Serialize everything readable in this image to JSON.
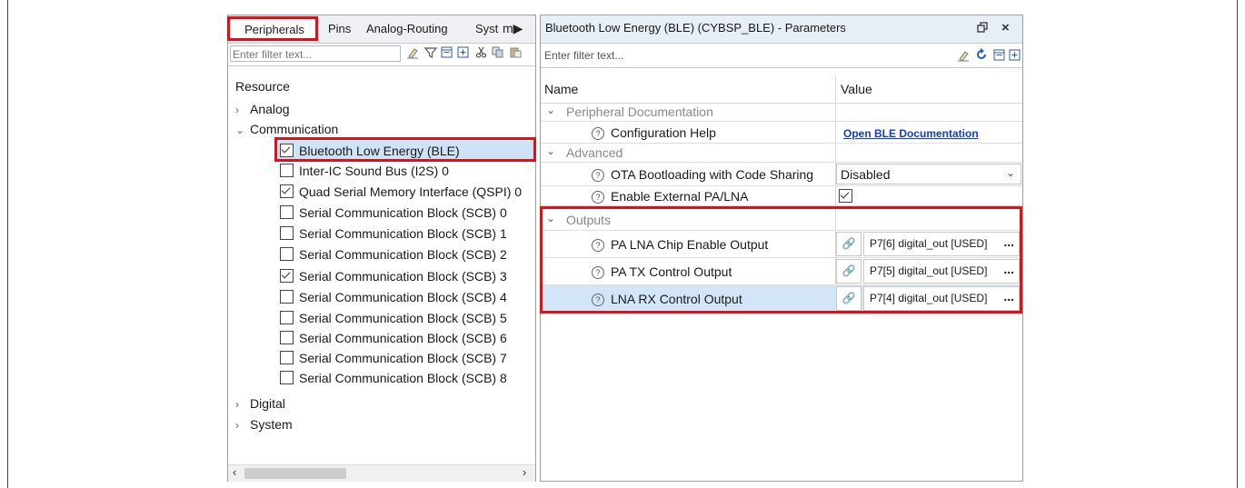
{
  "left_panel": {
    "tabs": [
      "Peripherals",
      "Pins",
      "Analog-Routing",
      "Syst"
    ],
    "tab_overflow_glyph": "m▶",
    "filter_placeholder": "Enter filter text...",
    "resource_header": "Resource",
    "categories": {
      "analog": "Analog",
      "communication": "Communication",
      "digital": "Digital",
      "system": "System"
    },
    "communication_items": [
      {
        "label": "Bluetooth Low Energy (BLE)",
        "checked": true
      },
      {
        "label": "Inter-IC Sound Bus (I2S) 0",
        "checked": false
      },
      {
        "label": "Quad Serial Memory Interface (QSPI) 0",
        "checked": true
      },
      {
        "label": "Serial Communication Block (SCB) 0",
        "checked": false
      },
      {
        "label": "Serial Communication Block (SCB) 1",
        "checked": false
      },
      {
        "label": "Serial Communication Block (SCB) 2",
        "checked": false
      },
      {
        "label": "Serial Communication Block (SCB) 3",
        "checked": true
      },
      {
        "label": "Serial Communication Block (SCB) 4",
        "checked": false
      },
      {
        "label": "Serial Communication Block (SCB) 5",
        "checked": false
      },
      {
        "label": "Serial Communication Block (SCB) 6",
        "checked": false
      },
      {
        "label": "Serial Communication Block (SCB) 7",
        "checked": false
      },
      {
        "label": "Serial Communication Block (SCB) 8",
        "checked": false
      }
    ]
  },
  "right_panel": {
    "title": "Bluetooth Low Energy (BLE) (CYBSP_BLE) - Parameters",
    "filter_placeholder": "Enter filter text...",
    "col_name": "Name",
    "col_value": "Value",
    "groups": {
      "peripheral_documentation": "Peripheral Documentation",
      "advanced": "Advanced",
      "outputs": "Outputs"
    },
    "params": {
      "configuration_help": {
        "name": "Configuration Help",
        "value": "Open BLE Documentation"
      },
      "ota_bootloading": {
        "name": "OTA Bootloading with Code Sharing",
        "value": "Disabled"
      },
      "external_pa_lna": {
        "name": "Enable External PA/LNA",
        "checked": true
      },
      "pa_lna_chip_enable": {
        "name": "PA LNA Chip Enable Output",
        "value": "P7[6] digital_out [USED]"
      },
      "pa_tx_control": {
        "name": "PA TX Control Output",
        "value": "P7[5] digital_out [USED]"
      },
      "lna_rx_control": {
        "name": "LNA RX Control Output",
        "value": "P7[4] digital_out [USED]"
      }
    },
    "more_glyph": "..."
  },
  "colors": {
    "highlight_red": "#e0101a",
    "selection_blue": "#cfe3f6",
    "link_blue": "#1040c0"
  }
}
